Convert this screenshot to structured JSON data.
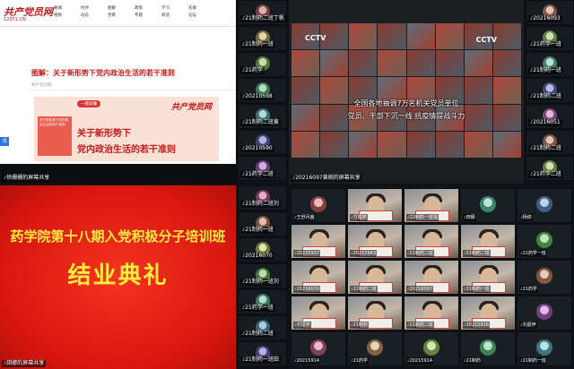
{
  "web": {
    "logo": "共产党员网",
    "url": "12371.CN",
    "nav": [
      "要闻",
      "时评",
      "图解",
      "政策",
      "学习",
      "先锋",
      "视频",
      "动态",
      "党章",
      "专题",
      "阅读",
      "论坛"
    ],
    "article_title": "图解：关于新形势下党内政治生活的若干准则",
    "meta": "共产党员网",
    "banner_tag": "一图读懂",
    "banner_logo": "共产党员网",
    "banner_side": "关于新形势下党内政治生活的若干准则",
    "banner_line1": "关于新形势下",
    "banner_line2": "党内政治生活的若干准则",
    "side_button": "顶",
    "share_label": "徐姗姗的屏幕共享"
  },
  "news": {
    "logo": "CCTV",
    "logo2": "CCTV",
    "caption1": "全国各地抽调7万名机关党员单位",
    "caption2": "党员、干部下沉一线 抗疫情提战斗力",
    "share_label": "20216097黄婉的屏幕共享"
  },
  "slide": {
    "title": "药学院第十八期入党积极分子培训班",
    "subtitle": "结业典礼",
    "share_label": "田娜的屏幕共享"
  },
  "left_column": [
    "徐姗姗的屏幕共享",
    "21制药二班丁帆",
    "21制药一班",
    "21药学",
    "20210598",
    "21制药二班黄",
    "20210590",
    "21药学二班",
    "21制药二班刘",
    "21制药一班",
    "20216070",
    "21制药一班刘",
    "21药学一班",
    "21制药二班",
    "21制药一班田"
  ],
  "right_column": [
    "20216093",
    "21药学一班",
    "21制药一班",
    "21制药二班",
    "20216051",
    "21制药二班",
    "21药学二班"
  ],
  "grid": [
    "王舒月茜",
    "方霞婷",
    "22制药一班钱",
    "田娜",
    "杨焯",
    "20215937",
    "20215943",
    "21制药二班",
    "21制药二班",
    "21药学一班",
    "20216070",
    "22制药二班",
    "20216097",
    "21制药一班",
    "21药学",
    "刘思宇",
    "21制药",
    "21制药二班",
    "20215916",
    "刘嘉伊",
    "20215914",
    "21药学",
    "20215914",
    "21制药",
    "21制药一班"
  ]
}
